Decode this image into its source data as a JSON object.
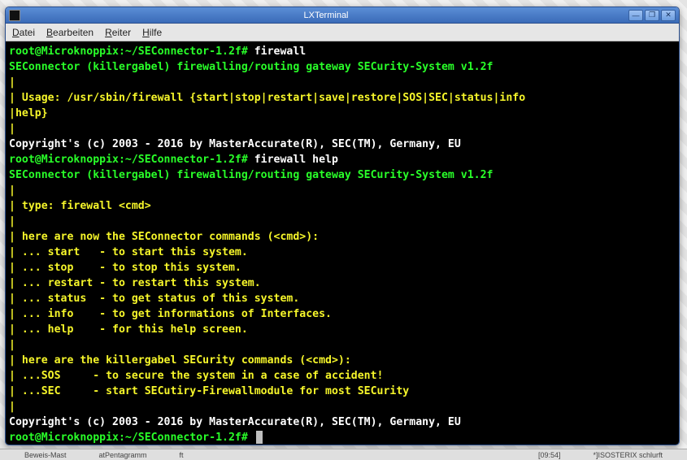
{
  "window": {
    "title": "LXTerminal"
  },
  "menubar": {
    "items": [
      {
        "label": "Datei",
        "ul_index": 0
      },
      {
        "label": "Bearbeiten",
        "ul_index": 0
      },
      {
        "label": "Reiter",
        "ul_index": 0
      },
      {
        "label": "Hilfe",
        "ul_index": 0
      }
    ]
  },
  "title_buttons": {
    "minimize": "—",
    "maximize": "❐",
    "close": "✕"
  },
  "terminal": {
    "prompt1": "root@Microknoppix:~/SEConnector-1.2f#",
    "cmd1": " firewall",
    "header": "SEConnector (killergabel) firewalling/routing gateway SECurity-System v1.2f",
    "pipe": "|",
    "usage": "| Usage: /usr/sbin/firewall {start|stop|restart|save|restore|SOS|SEC|status|info",
    "usage2": "|help}",
    "copyright": "Copyright's (c) 2003 - 2016 by MasterAccurate(R), SEC(TM), Germany, EU",
    "prompt2": "root@Microknoppix:~/SEConnector-1.2f#",
    "cmd2": " firewall help",
    "header2": "SEConnector (killergabel) firewalling/routing gateway SECurity-System v1.2f",
    "type_line": "| type: firewall <cmd>",
    "sec_head": "| here are now the SEConnector commands (<cmd>):",
    "l_start": "| ... start   - to start this system.",
    "l_stop": "| ... stop    - to stop this system.",
    "l_restart": "| ... restart - to restart this system.",
    "l_status": "| ... status  - to get status of this system.",
    "l_info": "| ... info    - to get informations of Interfaces.",
    "l_help": "| ... help    - for this help screen.",
    "kg_head": "| here are the killergabel SECurity commands (<cmd>):",
    "l_sos": "| ...SOS     - to secure the system in a case of accident!",
    "l_sec": "| ...SEC     - start SECutiry-Firewallmodule for most SECurity",
    "copyright2": "Copyright's (c) 2003 - 2016 by MasterAccurate(R), SEC(TM), Germany, EU",
    "prompt3": "root@Microknoppix:~/SEConnector-1.2f# "
  },
  "taskbar": {
    "item1": "Beweis-Mast",
    "item2": "atPentagramm",
    "item3": "ft",
    "clock": "[09:54]",
    "tray": "*]ISOSTERIX schlurft"
  }
}
